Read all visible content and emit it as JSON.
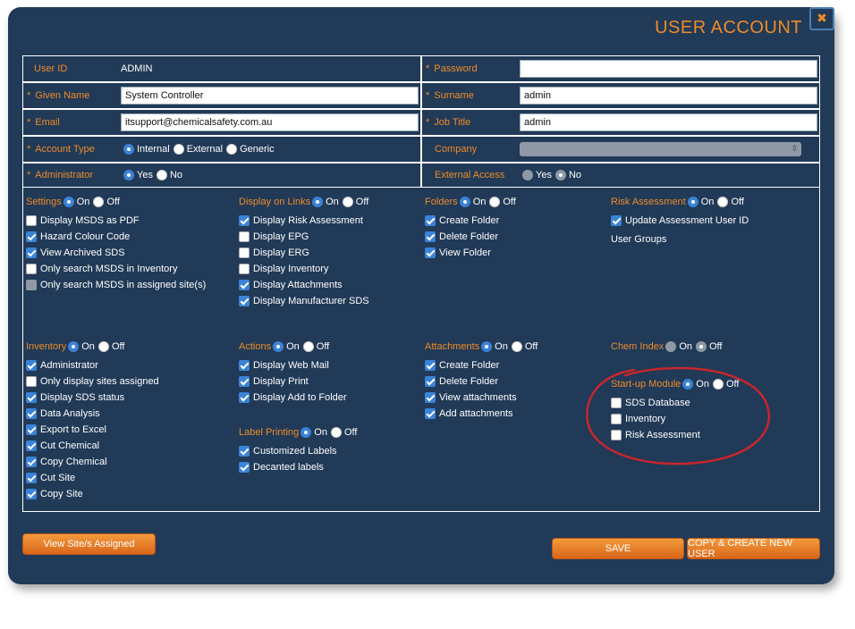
{
  "dialog": {
    "title": "USER ACCOUNT",
    "close_label": "✖"
  },
  "fields": {
    "user_id_label": "User ID",
    "user_id_value": "ADMIN",
    "password_label": "Password",
    "password_value": "",
    "given_name_label": "Given Name",
    "given_name_value": "System Controller",
    "surname_label": "Surname",
    "surname_value": "admin",
    "email_label": "Email",
    "email_value": "itsupport@chemicalsafety.com.au",
    "job_title_label": "Job Title",
    "job_title_value": "admin",
    "account_type_label": "Account Type",
    "account_type_options": [
      "Internal",
      "External",
      "Generic"
    ],
    "account_type_selected": "Internal",
    "company_label": "Company",
    "administrator_label": "Administrator",
    "administrator_yes": "Yes",
    "administrator_no": "No",
    "external_access_label": "External Access",
    "external_access_yes": "Yes",
    "external_access_no": "No",
    "required_mark": "*"
  },
  "toggle": {
    "on": "On",
    "off": "Off"
  },
  "sections": {
    "settings": {
      "title": "Settings",
      "items": [
        {
          "label": "Display MSDS as PDF",
          "checked": false
        },
        {
          "label": "Hazard Colour Code",
          "checked": true
        },
        {
          "label": "View Archived SDS",
          "checked": true
        },
        {
          "label": "Only search MSDS in Inventory",
          "checked": false
        },
        {
          "label": "Only search MSDS in assigned site(s)",
          "checked": false
        }
      ]
    },
    "display_links": {
      "title": "Display on Links",
      "items": [
        {
          "label": "Display Risk Assessment",
          "checked": true
        },
        {
          "label": "Display EPG",
          "checked": false
        },
        {
          "label": "Display ERG",
          "checked": false
        },
        {
          "label": "Display Inventory",
          "checked": false
        },
        {
          "label": "Display Attachments",
          "checked": true
        },
        {
          "label": "Display Manufacturer SDS",
          "checked": true
        }
      ]
    },
    "folders": {
      "title": "Folders",
      "items": [
        {
          "label": "Create Folder",
          "checked": true
        },
        {
          "label": "Delete Folder",
          "checked": true
        },
        {
          "label": "View Folder",
          "checked": true
        }
      ]
    },
    "risk_assessment": {
      "title": "Risk Assessment",
      "items": [
        {
          "label": "Update Assessment User ID",
          "checked": true
        }
      ],
      "user_groups": "User Groups"
    },
    "inventory": {
      "title": "Inventory",
      "items": [
        {
          "label": "Administrator",
          "checked": true
        },
        {
          "label": "Only display sites assigned",
          "checked": false
        },
        {
          "label": "Display SDS status",
          "checked": true
        },
        {
          "label": "Data Analysis",
          "checked": true
        },
        {
          "label": "Export to Excel",
          "checked": true
        },
        {
          "label": "Cut Chemical",
          "checked": true
        },
        {
          "label": "Copy Chemical",
          "checked": true
        },
        {
          "label": "Cut Site",
          "checked": true
        },
        {
          "label": "Copy Site",
          "checked": true
        }
      ]
    },
    "actions": {
      "title": "Actions",
      "items": [
        {
          "label": "Display Web Mail",
          "checked": true
        },
        {
          "label": "Display Print",
          "checked": true
        },
        {
          "label": "Display Add to Folder",
          "checked": true
        }
      ]
    },
    "label_printing": {
      "title": "Label Printing",
      "items": [
        {
          "label": "Customized Labels",
          "checked": true
        },
        {
          "label": "Decanted labels",
          "checked": true
        }
      ]
    },
    "attachments": {
      "title": "Attachments",
      "items": [
        {
          "label": "Create Folder",
          "checked": true
        },
        {
          "label": "Delete Folder",
          "checked": true
        },
        {
          "label": "View attachments",
          "checked": true
        },
        {
          "label": "Add attachments",
          "checked": true
        }
      ]
    },
    "chem_index": {
      "title": "Chem Index"
    },
    "startup_module": {
      "title": "Start-up Module",
      "items": [
        {
          "label": "SDS Database",
          "checked": false
        },
        {
          "label": "Inventory",
          "checked": false
        },
        {
          "label": "Risk Assessment",
          "checked": false
        }
      ]
    }
  },
  "buttons": {
    "view_sites": "View Site/s Assigned",
    "save": "SAVE",
    "copy_create": "COPY & CREATE NEW USER"
  },
  "colors": {
    "background": "#213a57",
    "accent": "#ee8b2a",
    "checkbox_blue": "#3b83d6",
    "annotation_red": "#c8262c"
  }
}
